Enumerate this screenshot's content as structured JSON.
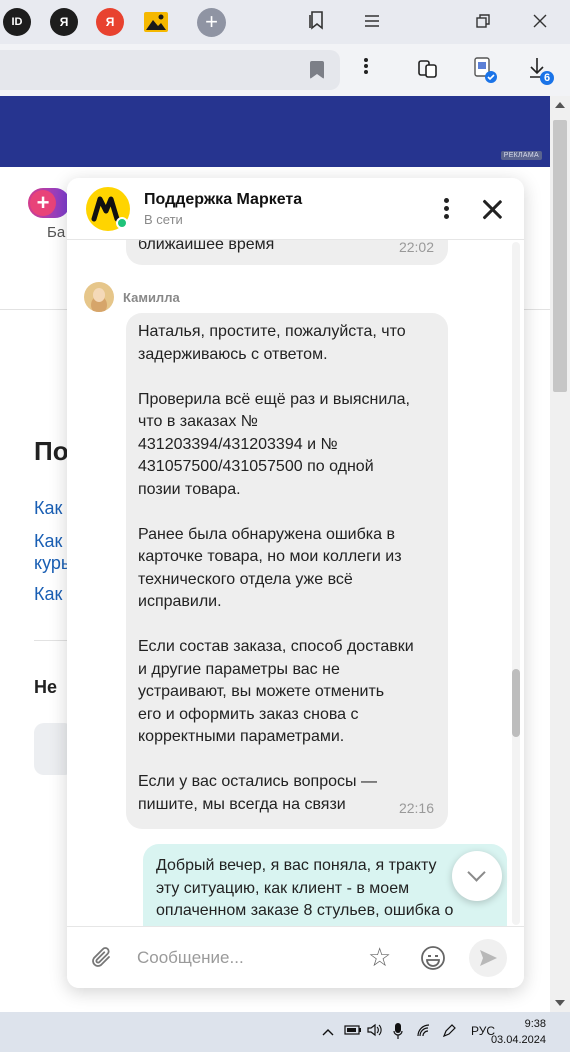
{
  "browser": {
    "tabs": [
      {
        "label": "ID"
      },
      {
        "label": "Я"
      },
      {
        "label": "Я"
      }
    ],
    "new_tab": "+",
    "downloads_count": "6"
  },
  "page": {
    "ad_label": "РЕКЛАМА",
    "bal_text": "Ба",
    "heading": "По",
    "links": [
      "Как",
      "Как",
      "куры",
      "Как"
    ],
    "subheading": "Не"
  },
  "chat": {
    "title": "Поддержка Маркета",
    "status": "В сети",
    "input_placeholder": "Сообщение...",
    "messages": [
      {
        "author": "",
        "lines": [
          "ближайшее время"
        ],
        "time": "22:02"
      },
      {
        "author": "Камилла",
        "lines": [
          "Наталья, простите, пожалуйста, что",
          "задерживаюсь с ответом.",
          "",
          "Проверила всё ещё раз и выяснила,",
          "что в заказах №",
          "431203394/431203394 и №",
          "431057500/431057500 по одной",
          "позии товара.",
          "",
          "Ранее была обнаружена ошибка в",
          "карточке товара, но мои коллеги из",
          "технического отдела уже всё",
          "исправили.",
          "",
          "Если состав заказа, способ доставки",
          "и другие параметры вас не",
          "устраивают, вы можете отменить",
          "его и оформить заказ снова с",
          "корректными параметрами.",
          "",
          "Если у вас остались вопросы —",
          "пишите, мы всегда на связи"
        ],
        "time": "22:16"
      },
      {
        "author": "user",
        "lines": [
          "Добрый вечер, я вас поняла, я тракту",
          "эту ситуацию, как клиент - в моем",
          "оплаченном заказе 8 стульев, ошибка о",
          "                                        "
        ],
        "time": ""
      }
    ]
  },
  "taskbar": {
    "lang": "РУС",
    "time": "9:38",
    "date": "03.04.2024"
  },
  "colors": {
    "banner": "#26348f",
    "brand_yellow": "#ffd400",
    "online": "#1fc37a",
    "link": "#1a5fb4",
    "my_bubble": "#d9f4f1"
  }
}
